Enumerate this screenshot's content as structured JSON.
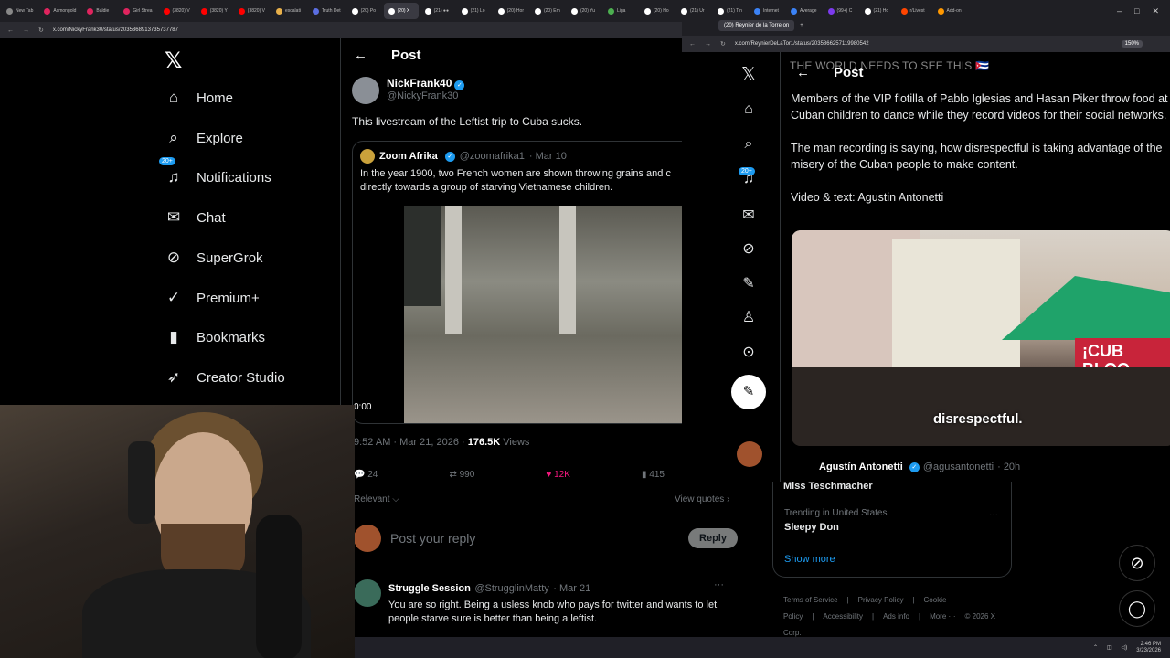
{
  "browser": {
    "tabs": [
      "New Tab",
      "Asmongold",
      "Baldie",
      "Girl Strea",
      "(3820) V",
      "(3820) Y",
      "(3820) V",
      "escalati",
      "Truth Det",
      "(20) Po",
      "(20) X",
      "(21) ●●",
      "(21) Lo",
      "(20) Hor",
      "(20) Em",
      "(20) Yu",
      "Liga",
      "(20) Ho",
      "(21) Ur",
      "(21) Tin",
      "Internet",
      "Average",
      "(99+) C",
      "(21) Ho",
      "r/Livest",
      "Add-on"
    ],
    "url": "x.com/NickyFrank30/status/2035368913735737787",
    "window_controls": [
      "–",
      "□",
      "✕"
    ]
  },
  "sidebar": {
    "logo": "𝕏",
    "items": [
      {
        "label": "Home",
        "icon": "⌂"
      },
      {
        "label": "Explore",
        "icon": "⌕"
      },
      {
        "label": "Notifications",
        "icon": "♫",
        "badge": "20+"
      },
      {
        "label": "Chat",
        "icon": "✉"
      },
      {
        "label": "SuperGrok",
        "icon": "⊘"
      },
      {
        "label": "Premium+",
        "icon": "✓"
      },
      {
        "label": "Bookmarks",
        "icon": "▮"
      },
      {
        "label": "Creator Studio",
        "icon": "➶"
      }
    ]
  },
  "post": {
    "back": "←",
    "header": "Post",
    "author_name": "NickFrank40",
    "author_handle": "@NickyFrank30",
    "text": "This livestream of the Leftist trip to Cuba sucks.",
    "quote": {
      "name": "Zoom Afrika",
      "handle": "@zoomafrika1",
      "date": "· Mar 10",
      "text": "In the year 1900, two French women are shown throwing grains and c\ndirectly towards a group of starving Vietnamese children."
    },
    "timecode": "0:00",
    "stamp_time": "9:52 AM · Mar 21, 2026 · ",
    "views_count": "176.5K",
    "views_label": " Views",
    "actions": {
      "replies": "24",
      "reposts": "990",
      "likes": "12K",
      "bookmarks": "415"
    },
    "relevant": "Relevant ⌵",
    "view_quotes": "View quotes ›",
    "reply_placeholder": "Post your reply",
    "reply_button": "Reply",
    "comment": {
      "name": "Struggle Session",
      "handle": "@StrugglinMatty",
      "date": "· Mar 21",
      "more": "···",
      "text": "You are so right. Being a usless knob who pays for twitter and wants to let people starve sure is better than being a leftist."
    }
  },
  "trending": {
    "top_item": "Miss Teschmacher",
    "meta": "Trending in United States",
    "item": "Sleepy Don",
    "more": "···",
    "show_more": "Show more"
  },
  "footer": {
    "links": [
      "Terms of Service",
      "|",
      "Privacy Policy",
      "|",
      "Cookie Policy",
      "|",
      "Accessibility",
      "|",
      "Ads info",
      "|",
      "More ···",
      "© 2026 X Corp."
    ]
  },
  "window2": {
    "tab_label": "(20) Reynier de la Torre on",
    "url": "x.com/ReynierDeLaTor1/status/2035866257119980542",
    "zoom": "150%",
    "nav_icons": [
      "𝕏",
      "⌂",
      "⌕",
      "♫",
      "✉",
      "⊘",
      "✎",
      "♙",
      "⊙"
    ],
    "badge": "20+",
    "compose": "✎",
    "header_back": "←",
    "header": "Post",
    "faded_title": "THE WORLD NEEDS TO SEE THIS 🇨🇺",
    "paragraphs": [
      "Members of the VIP flotilla of Pablo Iglesias and Hasan Piker throw food at Cuban children to dance while they record videos for their social networks.",
      "The man recording is saying, how disrespectful is taking advantage of the misery of the Cuban people to make content.",
      "Video & text: Agustin Antonetti"
    ],
    "video_caption": "disrespectful.",
    "banner_text": "¡CUB\nBLOQ",
    "author_name": "Agustín Antonetti",
    "author_handle": "@agusantonetti",
    "author_time": "· 20h"
  },
  "taskbar": {
    "time": "2:46 PM",
    "date": "3/23/2026"
  },
  "colors": {
    "accent": "#1d9bf0",
    "like": "#f91880",
    "muted": "#71767b",
    "bg": "#000000"
  }
}
